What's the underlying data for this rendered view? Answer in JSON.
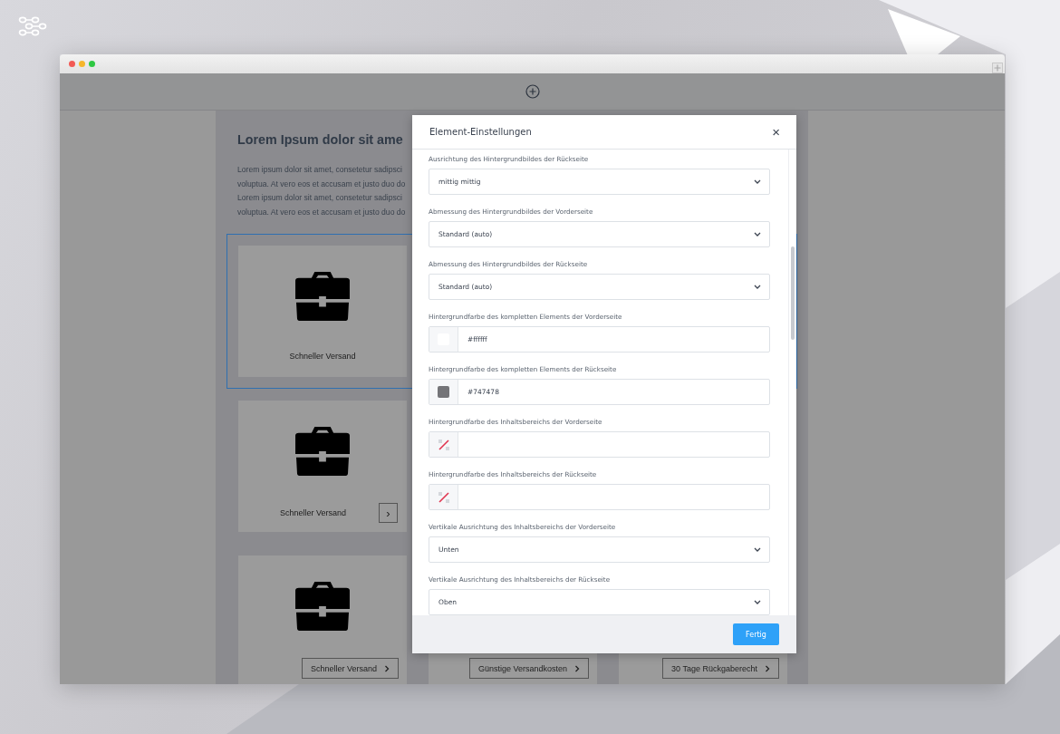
{
  "page": {
    "heading": "Lorem Ipsum dolor sit ame",
    "paragraph_lines": [
      "Lorem ipsum dolor sit amet, consetetur sadipsci",
      "voluptua. At vero eos et accusam et justo duo do",
      "Lorem ipsum dolor sit amet, consetetur sadipsci",
      "voluptua. At vero eos et accusam et justo duo do"
    ],
    "rows": [
      {
        "selected": true,
        "cards": [
          {
            "kind": "caption",
            "label": "Schneller Versand"
          }
        ]
      },
      {
        "selected": false,
        "cards": [
          {
            "kind": "caption-arrow",
            "label": "Schneller Versand",
            "arrow": "›"
          }
        ]
      },
      {
        "selected": false,
        "cards": [
          {
            "kind": "button",
            "label": "Schneller Versand"
          },
          {
            "kind": "button",
            "label": "Günstige Versandkosten"
          },
          {
            "kind": "button",
            "label": "30 Tage Rückgaberecht"
          }
        ]
      }
    ]
  },
  "dialog": {
    "title": "Element-Einstellungen",
    "close": "×",
    "fields": [
      {
        "kind": "select",
        "label": "Ausrichtung des Hintergrundbildes der Rückseite",
        "value": "mittig mittig"
      },
      {
        "kind": "select",
        "label": "Abmessung des Hintergrundbildes der Vorderseite",
        "value": "Standard (auto)"
      },
      {
        "kind": "select",
        "label": "Abmessung des Hintergrundbildes der Rückseite",
        "value": "Standard (auto)"
      },
      {
        "kind": "color",
        "label": "Hintergrundfarbe des kompletten Elements der Vorderseite",
        "value": "#ffffff",
        "color": "#ffffff"
      },
      {
        "kind": "color",
        "label": "Hintergrundfarbe des kompletten Elements der Rückseite",
        "value": "#747478",
        "color": "#747478"
      },
      {
        "kind": "color",
        "label": "Hintergrundfarbe des Inhaltsbereichs der Vorderseite"
      },
      {
        "kind": "color",
        "label": "Hintergrundfarbe des Inhaltsbereichs der Rückseite"
      },
      {
        "kind": "select",
        "label": "Vertikale Ausrichtung des Inhaltsbereichs der Vorderseite",
        "value": "Unten"
      },
      {
        "kind": "select",
        "label": "Vertikale Ausrichtung des Inhaltsbereichs der Rückseite",
        "value": "Oben"
      }
    ],
    "done_button": "Fertig"
  }
}
